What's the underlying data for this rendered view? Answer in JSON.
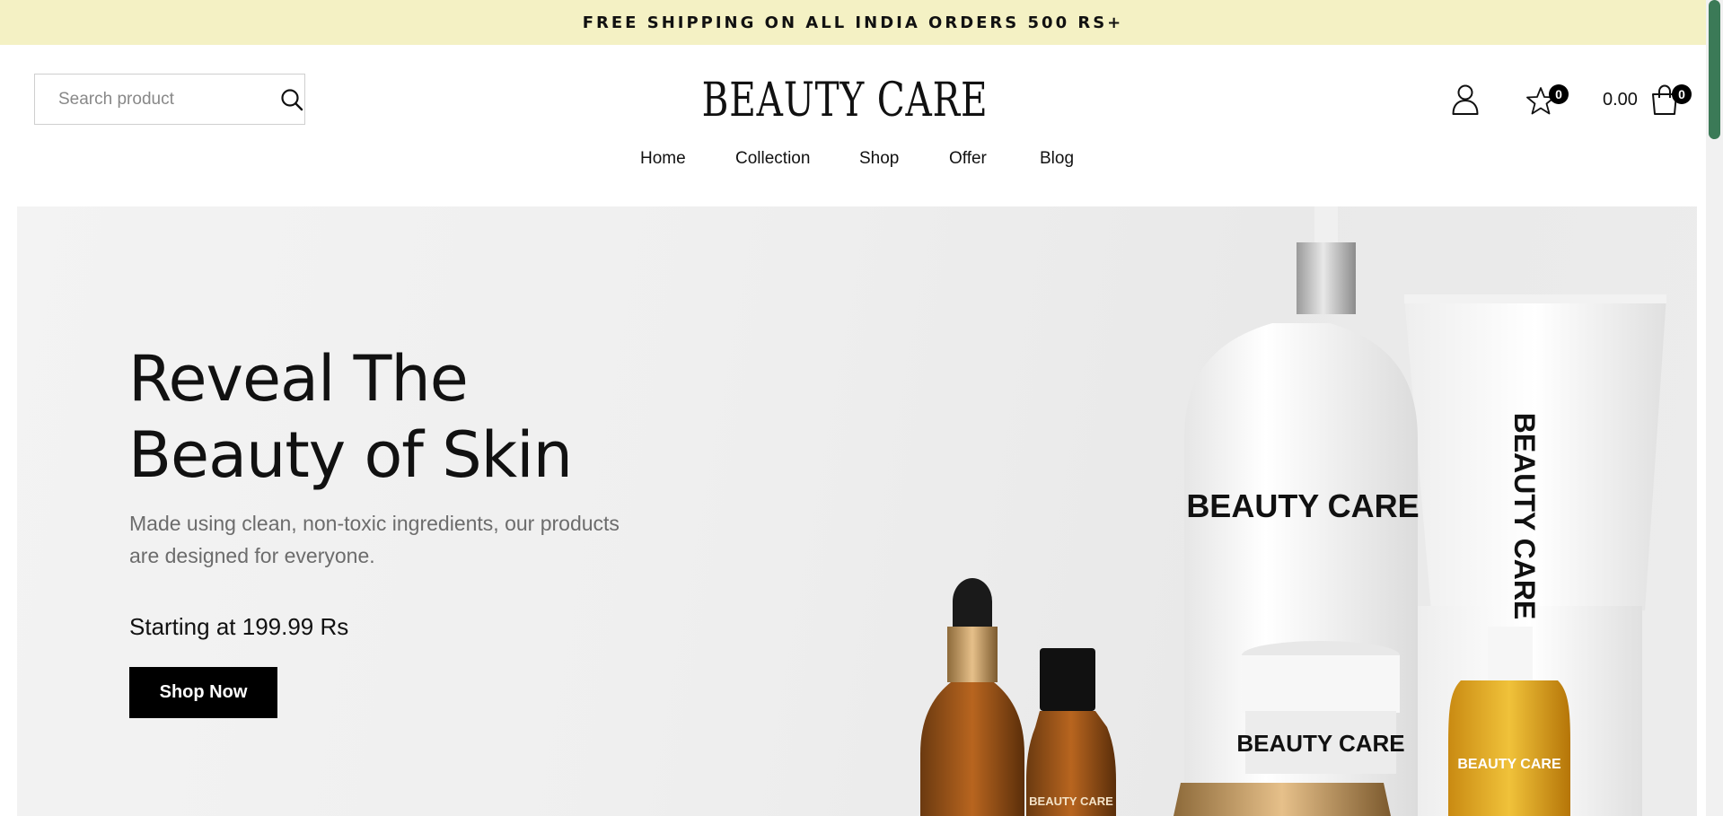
{
  "announcement": "FREE SHIPPING ON ALL INDIA ORDERS 500 RS+",
  "search": {
    "placeholder": "Search product"
  },
  "logo": "BEAUTY CARE",
  "header": {
    "wishlist_count": "0",
    "cart_total": "0.00",
    "cart_count": "0"
  },
  "nav": [
    "Home",
    "Collection",
    "Shop",
    "Offer",
    "Blog"
  ],
  "hero": {
    "title_line1": "Reveal The",
    "title_line2": "Beauty of Skin",
    "desc_line1": "Made using clean, non-toxic ingredients, our products",
    "desc_line2": "are designed for everyone.",
    "price": "Starting at 199.99 Rs",
    "cta": "Shop Now"
  },
  "product_labels": {
    "bottle": "BEAUTY CARE",
    "tube": "BEAUTY CARE",
    "jar": "BEAUTY CARE",
    "small_bottle": "BEAUTY CARE",
    "amber_bottle": "BEAUTY CARE"
  },
  "icons": {
    "search": "search-icon",
    "account": "user-icon",
    "wishlist": "star-icon",
    "cart": "shopping-bag-icon"
  },
  "colors": {
    "announcement_bg": "#f4f1c4",
    "cta_bg": "#000000",
    "badge_bg": "#000000",
    "scroll_thumb": "#3b7a57"
  }
}
